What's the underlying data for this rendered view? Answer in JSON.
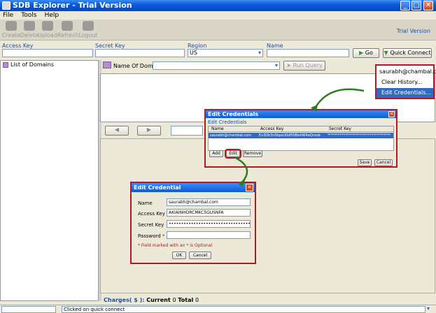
{
  "window": {
    "title": "SDB Explorer - Trial Version"
  },
  "menu": [
    "File",
    "Tools",
    "Help"
  ],
  "toolbar": {
    "buttons": [
      "Create",
      "Delete",
      "Upload",
      "Refresh",
      "Logout"
    ],
    "trial_label": "Trial Version"
  },
  "connection": {
    "access_key_label": "Access Key",
    "secret_key_label": "Secret Key",
    "region_label": "Region",
    "region_value": "US",
    "name_label": "Name",
    "go_label": "Go",
    "quick_connect_label": "Quick Connect"
  },
  "sidebar": {
    "title": "List of Domains"
  },
  "query": {
    "name_of_domain_label": "Name Of Domain",
    "run_query_label": "Run Query"
  },
  "dropdown_menu": {
    "items": [
      "saurabh@chambal.com",
      "Clear History...",
      "Edit Credentials..."
    ]
  },
  "edit_credentials": {
    "title": "Edit Credentials",
    "subtitle": "Edit Credentials",
    "columns": [
      "Name",
      "Access Key",
      "Secret Key"
    ],
    "row": {
      "name": "saurabh@chambal.com",
      "access_key": "Ev3Db3c0bpsU0dP0lBehW4eQrsob",
      "secret_key": "************************************"
    },
    "add_label": "Add",
    "edit_label": "Edit",
    "remove_label": "Remove",
    "save_label": "Save",
    "cancel_label": "Cancel"
  },
  "edit_credential": {
    "title": "Edit Credential",
    "name_label": "Name",
    "name_value": "saurabh@chambal.com",
    "access_key_label": "Access Key",
    "access_key_value": "AKIAINHDRCMKC5GUSNFA",
    "secret_key_label": "Secret Key",
    "secret_key_value": "••••••••••••••••••••••••••••••••••••",
    "password_label": "Password",
    "required_mark": "*",
    "note": "* Field marked with an * is Optional",
    "ok_label": "OK",
    "cancel_label": "Cancel"
  },
  "charges": {
    "label": "Charges( $ ):",
    "current_label": "Current",
    "current_value": "0",
    "total_label": "Total",
    "total_value": "0"
  },
  "statusbar": {
    "message": "Clicked on quick connect"
  }
}
